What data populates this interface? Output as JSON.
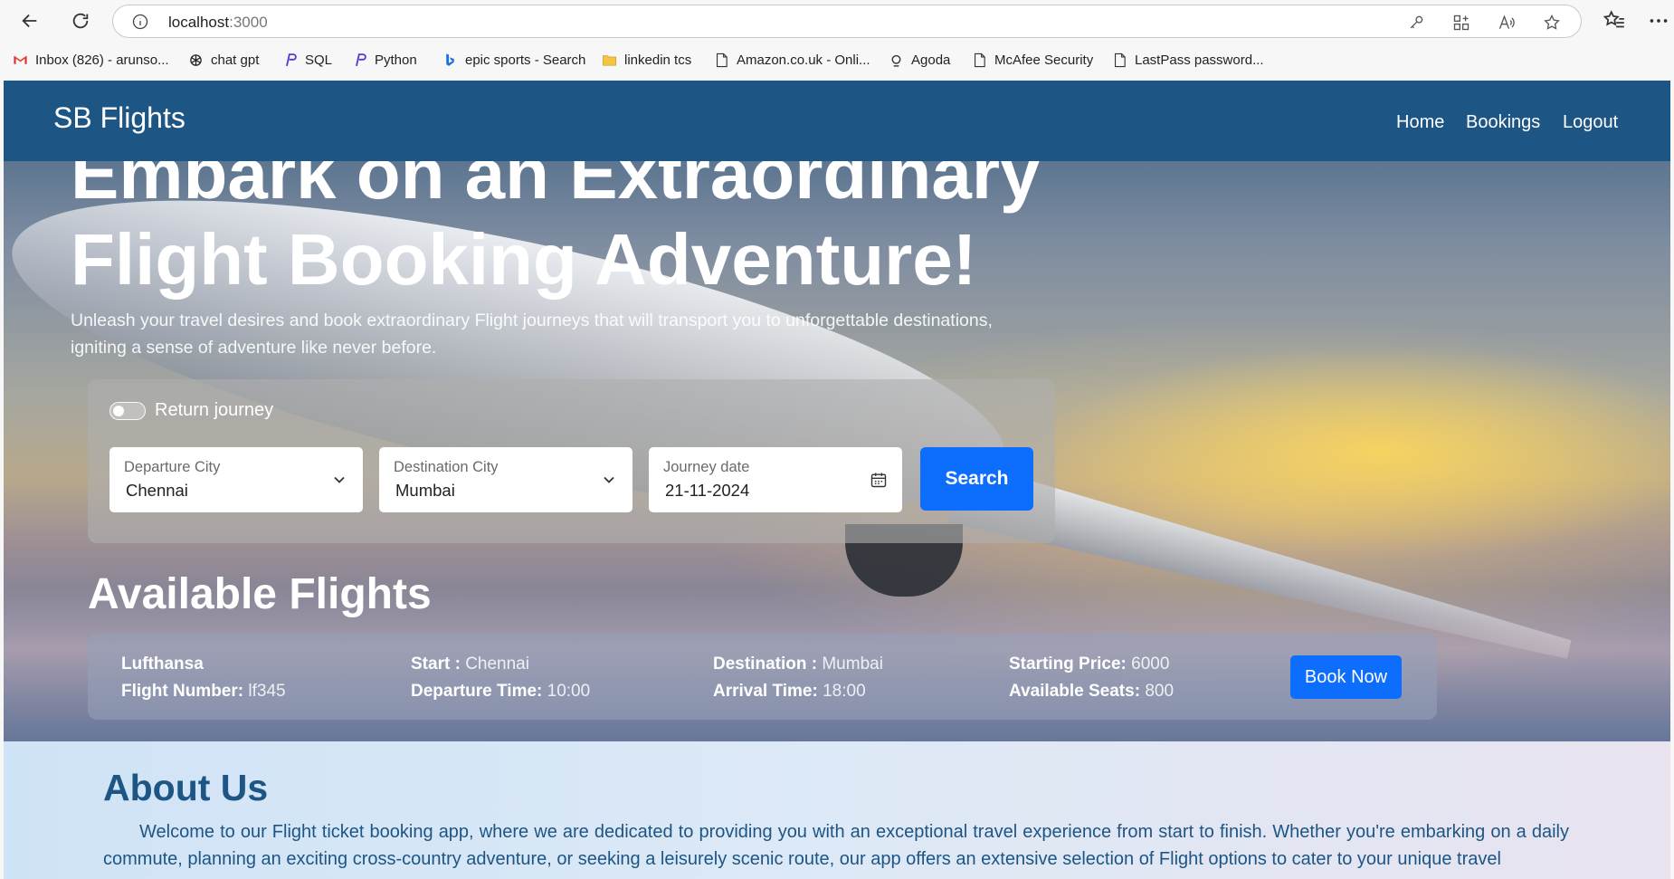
{
  "browser": {
    "url_host": "localhost",
    "url_port": ":3000",
    "bookmarks": [
      {
        "label": "Inbox (826) - arunso...",
        "icon": "gmail-icon"
      },
      {
        "label": "chat gpt",
        "icon": "openai-icon"
      },
      {
        "label": "SQL",
        "icon": "python-icon"
      },
      {
        "label": "Python",
        "icon": "python-icon"
      },
      {
        "label": "epic sports - Search",
        "icon": "bing-icon"
      },
      {
        "label": "linkedin tcs",
        "icon": "folder-icon"
      },
      {
        "label": "Amazon.co.uk - Onli...",
        "icon": "page-icon"
      },
      {
        "label": "Agoda",
        "icon": "agoda-icon"
      },
      {
        "label": "McAfee Security",
        "icon": "page-icon"
      },
      {
        "label": "LastPass password...",
        "icon": "page-icon"
      }
    ]
  },
  "navbar": {
    "brand": "SB Flights",
    "links": [
      "Home",
      "Bookings",
      "Logout"
    ]
  },
  "hero": {
    "title_line1": "Embark on an Extraordinary",
    "title_line2": "Flight Booking Adventure!",
    "subtitle": "Unleash your travel desires and book extraordinary Flight journeys that will transport you to unforgettable destinations, igniting a sense of adventure like never before."
  },
  "search": {
    "return_label": "Return journey",
    "return_checked": false,
    "departure": {
      "label": "Departure City",
      "value": "Chennai"
    },
    "destination": {
      "label": "Destination City",
      "value": "Mumbai"
    },
    "date": {
      "label": "Journey date",
      "value": "21-11-2024"
    },
    "button": "Search"
  },
  "flights": {
    "title": "Available Flights",
    "items": [
      {
        "airline": "Lufthansa",
        "flight_number_label": "Flight Number:",
        "flight_number": "lf345",
        "start_label": "Start :",
        "start": "Chennai",
        "departure_time_label": "Departure Time:",
        "departure_time": "10:00",
        "destination_label": "Destination :",
        "destination": "Mumbai",
        "arrival_time_label": "Arrival Time:",
        "arrival_time": "18:00",
        "price_label": "Starting Price:",
        "price": "6000",
        "seats_label": "Available Seats:",
        "seats": "800",
        "button": "Book Now"
      }
    ]
  },
  "about": {
    "title": "About Us",
    "text": "Welcome to our Flight ticket booking app, where we are dedicated to providing you with an exceptional travel experience from start to finish. Whether you're embarking on a daily commute, planning an exciting cross-country adventure, or seeking a leisurely scenic route, our app offers an extensive selection of Flight options to cater to your unique travel"
  },
  "colors": {
    "navbar": "#1d5585",
    "primary_button": "#0d6efd",
    "about_text": "#1d5585"
  }
}
